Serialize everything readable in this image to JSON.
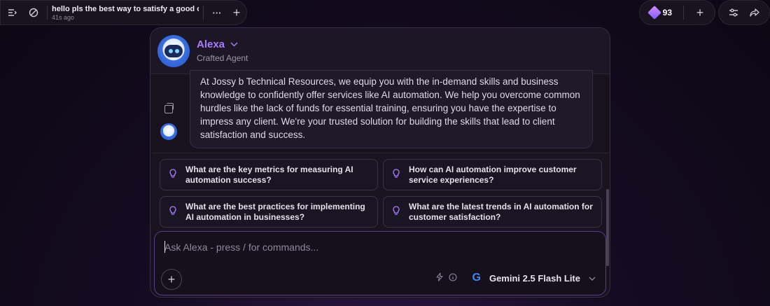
{
  "topbar": {
    "sidebar_icon": "sidebar-toggle-icon",
    "new_icon": "ban-icon",
    "conversation_title": "hello pls the best way to satisfy a good cli...",
    "conversation_time": "41s ago",
    "more_label": "···",
    "add_label": "+",
    "credits": "93",
    "plus_label": "+"
  },
  "agent": {
    "name": "Alexa",
    "subtitle": "Crafted Agent"
  },
  "message": {
    "text": "At Jossy b Technical Resources, we equip you with the in-demand skills and business knowledge to confidently offer services like AI automation. We help you overcome common hurdles like the lack of funds for essential training, ensuring you have the expertise to impress any client. We're your trusted solution for building the skills that lead to client satisfaction and success."
  },
  "suggestions": [
    "What are the key metrics for measuring AI automation success?",
    "How can AI automation improve customer service experiences?",
    "What are the best practices for implementing AI automation in businesses?",
    "What are the latest trends in AI automation for customer satisfaction?"
  ],
  "composer": {
    "placeholder": "Ask Alexa - press / for commands...",
    "model": "Gemini 2.5 Flash Lite",
    "model_logo": "G"
  },
  "colors": {
    "accent": "#a87bff",
    "background": "#0d0814",
    "panel": "#17121e"
  }
}
